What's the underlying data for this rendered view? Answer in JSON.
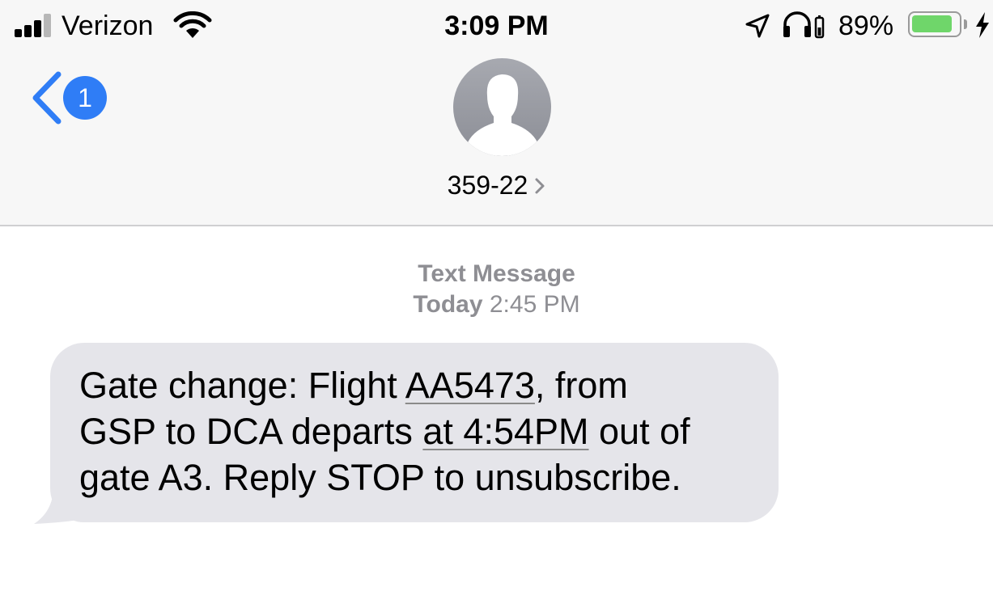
{
  "status_bar": {
    "carrier": "Verizon",
    "time": "3:09 PM",
    "battery_percent": "89%",
    "battery_level": 0.89,
    "icons": [
      "signal-icon",
      "wifi-icon",
      "location-icon",
      "headphones-icon",
      "battery-icon",
      "charging-icon"
    ]
  },
  "nav": {
    "back_badge": "1",
    "contact_name": "359-22",
    "avatar_icon": "person-silhouette-icon"
  },
  "conversation": {
    "message_type": "Text Message",
    "day": "Today",
    "time": "2:45 PM",
    "messages": [
      {
        "segments": [
          {
            "text": "Gate change: Flight ",
            "link": false
          },
          {
            "text": "AA5473",
            "link": true
          },
          {
            "text": ", from",
            "link": false
          },
          {
            "text": "GSP to DCA departs ",
            "link": false
          },
          {
            "text": "at 4:54PM",
            "link": true
          },
          {
            "text": " out of",
            "link": false
          },
          {
            "text": "gate A3. Reply STOP to unsubscribe.",
            "link": false
          }
        ]
      }
    ]
  },
  "colors": {
    "accent": "#2f7df6",
    "bubble": "#e5e5ea",
    "meta_text": "#8e8e93",
    "battery_fill": "#6fd66a",
    "header_bg": "#f7f7f7"
  }
}
